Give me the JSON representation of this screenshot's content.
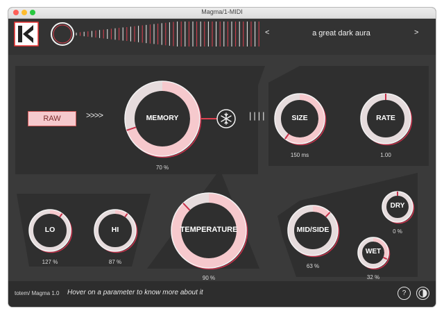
{
  "window": {
    "title": "Magma/1-MIDI"
  },
  "header": {
    "preset_prev": "<",
    "preset_name": "a great dark aura",
    "preset_next": ">"
  },
  "controls": {
    "raw_label": "RAW",
    "chevrons": ">>>>",
    "bars": "||||"
  },
  "knobs": {
    "memory": {
      "label": "MEMORY",
      "value": "70 %",
      "level": 0.7
    },
    "size": {
      "label": "SIZE",
      "value": "150 ms",
      "level": 0.6
    },
    "rate": {
      "label": "RATE",
      "value": "1.00",
      "level": 0.0
    },
    "lo": {
      "label": "LO",
      "value": "127 %",
      "level": 0.1
    },
    "hi": {
      "label": "HI",
      "value": "87 %",
      "level": 0.1
    },
    "temperature": {
      "label": "TEMPERATURE",
      "value": "90 %",
      "level": 0.88
    },
    "midside": {
      "label": "MID/SIDE",
      "value": "63 %",
      "level": 0.12
    },
    "dry": {
      "label": "DRY",
      "value": "0 %",
      "level": 0.0
    },
    "wet": {
      "label": "WET",
      "value": "32 %",
      "level": 0.32
    }
  },
  "footer": {
    "version": "totem/ Magma 1.0",
    "hint": "Hover on a parameter to know more about it",
    "help": "?"
  },
  "colors": {
    "accent": "#f6c9cd",
    "accent_dark": "#c8304a",
    "background": "#303030"
  },
  "icons": {
    "freeze": "snowflake-icon",
    "theme": "contrast-icon",
    "help": "help-icon",
    "logo": "totem-logo"
  }
}
